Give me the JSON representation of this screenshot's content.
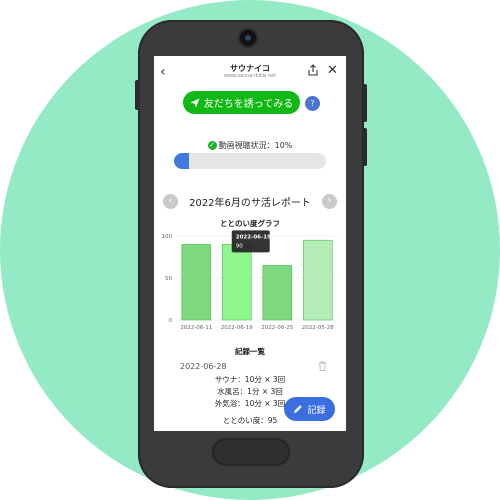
{
  "header": {
    "title": "サウナイコ",
    "url": "www.sauna-ikitai.net"
  },
  "invite": {
    "label": "友だちを誘ってみる",
    "help": "?"
  },
  "status": {
    "text": "動画視聴状況：10%",
    "progress": 0.1
  },
  "report": {
    "title": "2022年6月のサ活レポート",
    "prev": "‹",
    "next": "›"
  },
  "chart_data": {
    "type": "bar",
    "title": "ととのい度グラフ",
    "categories": [
      "2022-06-11",
      "2022-06-19",
      "2022-06-25",
      "2022-05-28"
    ],
    "values": [
      90,
      90,
      65,
      95
    ],
    "ylim": [
      0,
      100
    ],
    "yticks": [
      "0",
      "50",
      "100"
    ],
    "tooltip": {
      "label": "2022-06-19",
      "value": "90"
    },
    "colors": {
      "bar": "#7dd87f",
      "bar_highlight": "#8ff58d",
      "bar_light": "#b5ebb5",
      "stroke": "#4fc256"
    }
  },
  "records": {
    "heading": "記録一覧",
    "date": "2022-06-28",
    "lines": [
      "サウナ：10分 × 3回",
      "水風呂：1分 × 3回",
      "外気浴：10分 × 3回"
    ],
    "score": "ととのい度：95",
    "button": "記録"
  }
}
